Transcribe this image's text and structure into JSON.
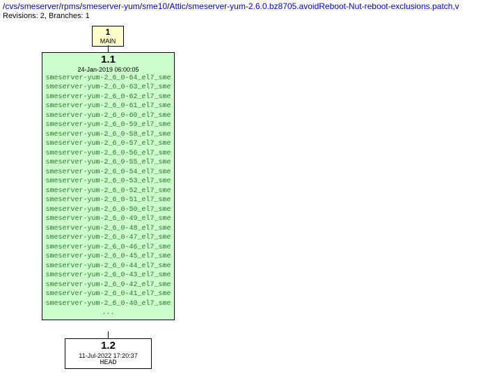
{
  "path_parts": [
    "/",
    "cvs",
    "/",
    "smeserver",
    "/",
    "rpms",
    "/",
    "smeserver-yum",
    "/",
    "sme10",
    "/",
    "Attic",
    "/",
    "smeserver-yum-2.6.0.bz8705.avoidReboot-Nut-reboot-exclusions.patch,v"
  ],
  "path_links": [
    1,
    3,
    5,
    7,
    9,
    11,
    13
  ],
  "revinfo": "Revisions: 2, Branches: 1",
  "main_node": {
    "num": "1",
    "label": "MAIN"
  },
  "rev1": {
    "rev": "1.1",
    "date": "24-Jan-2019 06:00:05",
    "tags": [
      "smeserver-yum-2_6_0-64_el7_sme",
      "smeserver-yum-2_6_0-63_el7_sme",
      "smeserver-yum-2_6_0-62_el7_sme",
      "smeserver-yum-2_6_0-61_el7_sme",
      "smeserver-yum-2_6_0-60_el7_sme",
      "smeserver-yum-2_6_0-59_el7_sme",
      "smeserver-yum-2_6_0-58_el7_sme",
      "smeserver-yum-2_6_0-57_el7_sme",
      "smeserver-yum-2_6_0-56_el7_sme",
      "smeserver-yum-2_6_0-55_el7_sme",
      "smeserver-yum-2_6_0-54_el7_sme",
      "smeserver-yum-2_6_0-53_el7_sme",
      "smeserver-yum-2_6_0-52_el7_sme",
      "smeserver-yum-2_6_0-51_el7_sme",
      "smeserver-yum-2_6_0-50_el7_sme",
      "smeserver-yum-2_6_0-49_el7_sme",
      "smeserver-yum-2_6_0-48_el7_sme",
      "smeserver-yum-2_6_0-47_el7_sme",
      "smeserver-yum-2_6_0-46_el7_sme",
      "smeserver-yum-2_6_0-45_el7_sme",
      "smeserver-yum-2_6_0-44_el7_sme",
      "smeserver-yum-2_6_0-43_el7_sme",
      "smeserver-yum-2_6_0-42_el7_sme",
      "smeserver-yum-2_6_0-41_el7_sme",
      "smeserver-yum-2_6_0-40_el7_sme"
    ],
    "more": "..."
  },
  "rev2": {
    "rev": "1.2",
    "date": "11-Jul-2022 17:20:37",
    "head": "HEAD"
  }
}
